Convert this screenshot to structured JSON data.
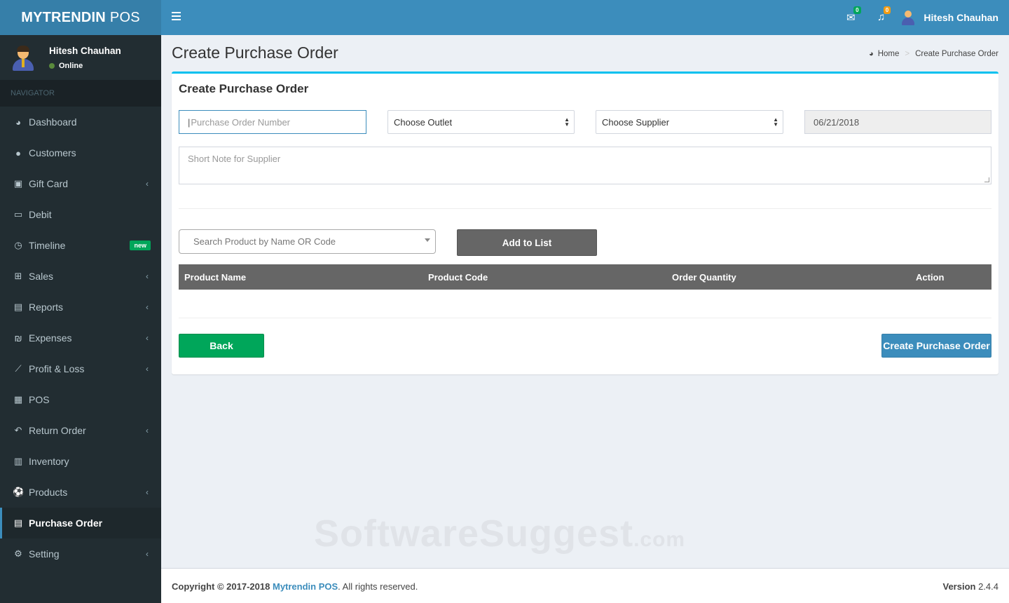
{
  "brand": {
    "bold": "MYTRENDIN",
    "light": "POS"
  },
  "user": {
    "name": "Hitesh Chauhan",
    "status": "Online"
  },
  "sidebar": {
    "header": "NAVIGATOR",
    "items": [
      {
        "label": "Dashboard",
        "icon": "dashboard-icon"
      },
      {
        "label": "Customers",
        "icon": "user-icon"
      },
      {
        "label": "Gift Card",
        "icon": "gift-icon"
      },
      {
        "label": "Debit",
        "icon": "money-icon"
      },
      {
        "label": "Timeline",
        "icon": "clock-icon",
        "badge": "new"
      },
      {
        "label": "Sales",
        "icon": "cart-icon"
      },
      {
        "label": "Reports",
        "icon": "book-icon"
      },
      {
        "label": "Expenses",
        "icon": "currency-icon"
      },
      {
        "label": "Profit & Loss",
        "icon": "line-chart-icon"
      },
      {
        "label": "POS",
        "icon": "calculator-icon"
      },
      {
        "label": "Return Order",
        "icon": "reply-icon"
      },
      {
        "label": "Inventory",
        "icon": "database-icon"
      },
      {
        "label": "Products",
        "icon": "soccer-ball-icon"
      },
      {
        "label": "Purchase Order",
        "icon": "book-icon"
      },
      {
        "label": "Setting",
        "icon": "gear-icon"
      }
    ]
  },
  "topbar": {
    "messages_count": "0",
    "notifications_count": "0",
    "user_name": "Hitesh Chauhan",
    "colors": {
      "messages_badge": "#00a65a",
      "notifications_badge": "#f39c12"
    }
  },
  "page": {
    "title": "Create Purchase Order",
    "breadcrumb": {
      "home": "Home",
      "current": "Create Purchase Order"
    }
  },
  "form": {
    "box_title": "Create Purchase Order",
    "po_number_placeholder": "Purchase Order Number",
    "outlet_selected": "Choose Outlet",
    "supplier_selected": "Choose Supplier",
    "date_value": "06/21/2018",
    "note_placeholder": "Short Note for Supplier",
    "product_search_placeholder": "Search Product by Name OR Code",
    "add_button": "Add to List",
    "table_headers": [
      "Product Name",
      "Product Code",
      "Order Quantity",
      "Action"
    ],
    "back_button": "Back",
    "create_button": "Create Purchase Order"
  },
  "watermark": {
    "main": "SoftwareSuggest",
    "suffix": ".com"
  },
  "footer": {
    "copyright_prefix": "Copyright © 2017-2018",
    "company": "Mytrendin POS",
    "rights": ". All rights reserved.",
    "version_label": "Version",
    "version": "2.4.4"
  }
}
